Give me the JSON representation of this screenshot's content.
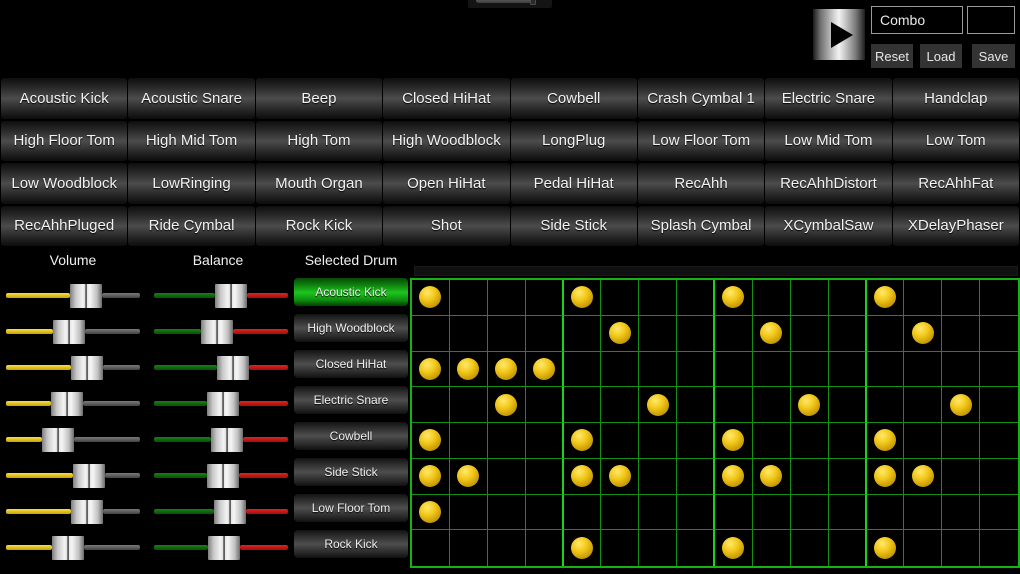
{
  "header": {
    "play_label": "play-icon",
    "combo_field_value": "Combo",
    "combo_field_placeholder": "",
    "extra_field_value": "",
    "extra_field_placeholder": "",
    "reset_label": "Reset",
    "load_label": "Load",
    "save_label": "Save",
    "tempo_slider_name": "tempo-slider"
  },
  "palette": {
    "items": [
      "Acoustic Kick",
      "Acoustic Snare",
      "Beep",
      "Closed HiHat",
      "Cowbell",
      "Crash Cymbal 1",
      "Electric Snare",
      "Handclap",
      "High Floor Tom",
      "High Mid Tom",
      "High Tom",
      "High Woodblock",
      "LongPlug",
      "Low Floor Tom",
      "Low Mid Tom",
      "Low Tom",
      "Low Woodblock",
      "LowRinging",
      "Mouth Organ",
      "Open HiHat",
      "Pedal HiHat",
      "RecAhh",
      "RecAhhDistort",
      "RecAhhFat",
      "RecAhhPluged",
      "Ride Cymbal",
      "Rock Kick",
      "Shot",
      "Side Stick",
      "Splash Cymbal",
      "XCymbalSaw",
      "XDelayPhaser"
    ]
  },
  "mixer": {
    "volume_header": "Volume",
    "balance_header": "Balance",
    "selected_drum_header": "Selected Drum",
    "volume_values": [
      60,
      44,
      61,
      42,
      34,
      63,
      61,
      43
    ],
    "balance_values": [
      58,
      44,
      59,
      50,
      54,
      50,
      57,
      51
    ]
  },
  "drum_list": {
    "items": [
      {
        "label": "Acoustic Kick",
        "selected": true
      },
      {
        "label": "High Woodblock",
        "selected": false
      },
      {
        "label": "Closed HiHat",
        "selected": false
      },
      {
        "label": "Electric Snare",
        "selected": false
      },
      {
        "label": "Cowbell",
        "selected": false
      },
      {
        "label": "Side Stick",
        "selected": false
      },
      {
        "label": "Low Floor Tom",
        "selected": false
      },
      {
        "label": "Rock Kick",
        "selected": false
      }
    ]
  },
  "sequencer": {
    "columns": 16,
    "bar_size": 4,
    "rows": [
      {
        "drum": "Acoustic Kick",
        "steps": [
          1,
          0,
          0,
          0,
          1,
          0,
          0,
          0,
          1,
          0,
          0,
          0,
          1,
          0,
          0,
          0
        ]
      },
      {
        "drum": "High Woodblock",
        "steps": [
          0,
          0,
          0,
          0,
          0,
          1,
          0,
          0,
          0,
          1,
          0,
          0,
          0,
          1,
          0,
          0
        ]
      },
      {
        "drum": "Closed HiHat",
        "steps": [
          1,
          1,
          1,
          1,
          0,
          0,
          0,
          0,
          0,
          0,
          0,
          0,
          0,
          0,
          0,
          0
        ]
      },
      {
        "drum": "Electric Snare",
        "steps": [
          0,
          0,
          1,
          0,
          0,
          0,
          1,
          0,
          0,
          0,
          1,
          0,
          0,
          0,
          1,
          0
        ]
      },
      {
        "drum": "Cowbell",
        "steps": [
          1,
          0,
          0,
          0,
          1,
          0,
          0,
          0,
          1,
          0,
          0,
          0,
          1,
          0,
          0,
          0
        ]
      },
      {
        "drum": "Side Stick",
        "steps": [
          1,
          1,
          0,
          0,
          1,
          1,
          0,
          0,
          1,
          1,
          0,
          0,
          1,
          1,
          0,
          0
        ]
      },
      {
        "drum": "Low Floor Tom",
        "steps": [
          1,
          0,
          0,
          0,
          0,
          0,
          0,
          0,
          0,
          0,
          0,
          0,
          0,
          0,
          0,
          0
        ]
      },
      {
        "drum": "Rock Kick",
        "steps": [
          0,
          0,
          0,
          0,
          1,
          0,
          0,
          0,
          1,
          0,
          0,
          0,
          1,
          0,
          0,
          0
        ]
      }
    ]
  },
  "colors": {
    "grid_green": "#15b215",
    "note_gold": "#f2c71a",
    "selected_green": "#1ec41e",
    "volume_track": "#f7de4a",
    "balance_left": "#178117",
    "balance_right": "#e22222"
  }
}
